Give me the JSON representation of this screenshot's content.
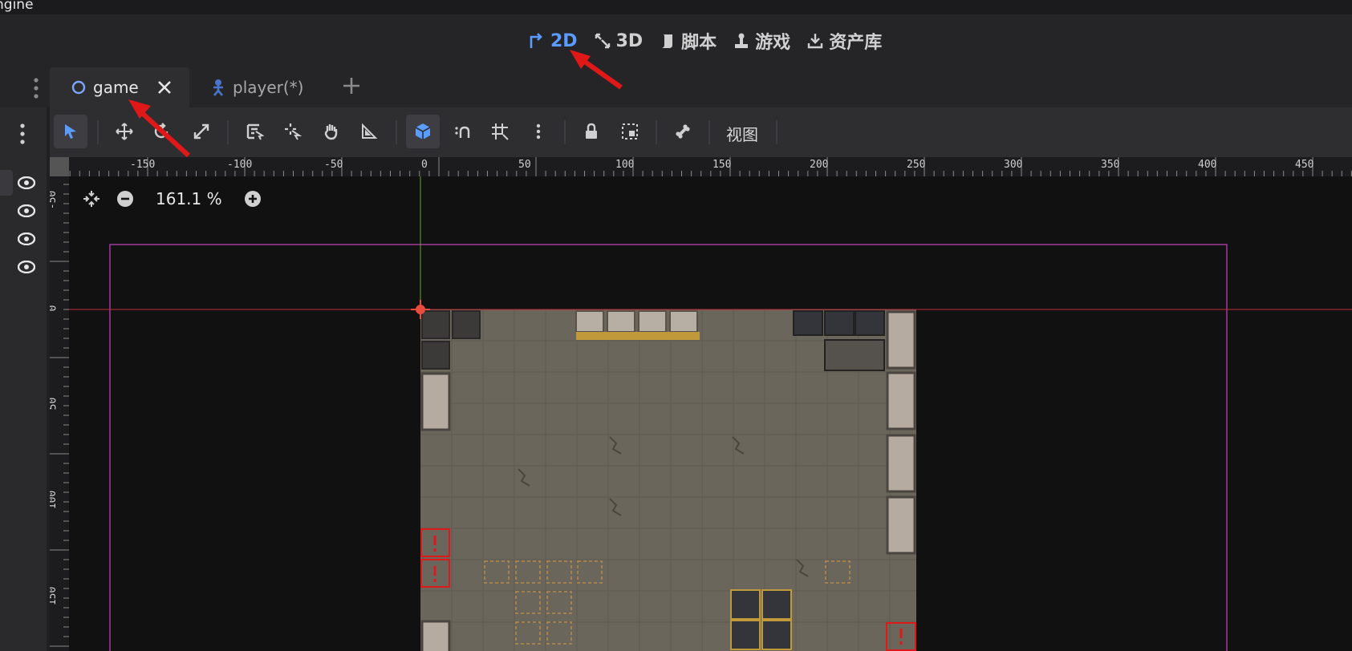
{
  "app": {
    "title_fragment": "ngine"
  },
  "main_menu": {
    "items": [
      {
        "label": "2D",
        "icon": "2d-icon",
        "active": true
      },
      {
        "label": "3D",
        "icon": "3d-icon",
        "active": false
      },
      {
        "label": "脚本",
        "icon": "script-icon",
        "active": false
      },
      {
        "label": "游戏",
        "icon": "game-icon",
        "active": false
      },
      {
        "label": "资产库",
        "icon": "asset-library-icon",
        "active": false
      }
    ]
  },
  "scene_tabs": [
    {
      "label": "game",
      "icon": "node-circle-icon",
      "active": true
    },
    {
      "label": "player(*)",
      "icon": "character-icon",
      "active": false
    }
  ],
  "toolbar": {
    "view_label": "视图"
  },
  "viewport": {
    "zoom": "161.1 %"
  },
  "rulers": {
    "horizontal": [
      "-150",
      "-100",
      "-50",
      "0",
      "50",
      "100",
      "150",
      "200",
      "250",
      "300",
      "350",
      "400",
      "450"
    ],
    "vertical": [
      "-50",
      "0",
      "50",
      "100",
      "150"
    ]
  },
  "colors": {
    "accent": "#5a9cff",
    "annotation": "#e01818",
    "x_axis": "#c0303a",
    "y_axis": "#6aa32a",
    "frame": "#a03a9a",
    "floor": "#6b665b"
  }
}
